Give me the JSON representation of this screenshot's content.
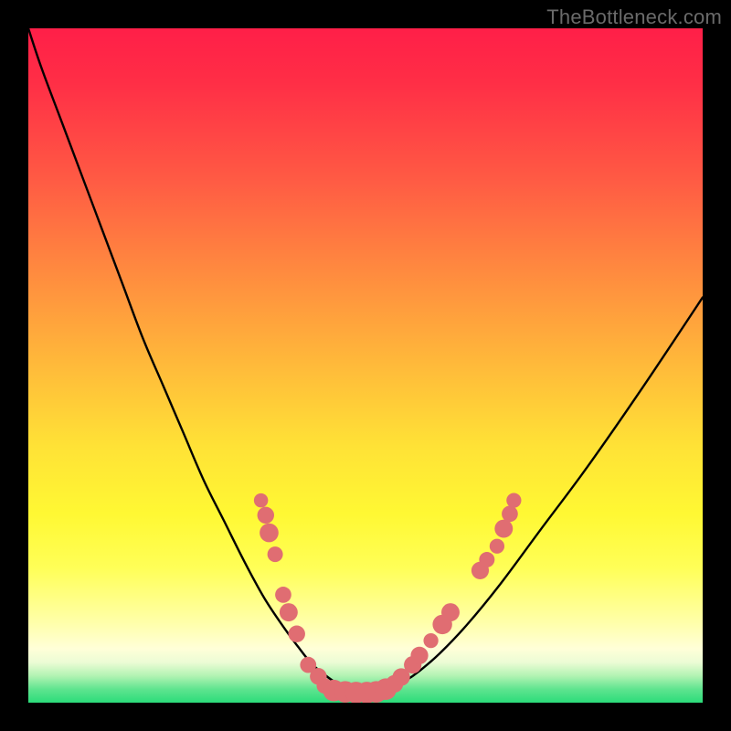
{
  "watermark": {
    "text": "TheBottleneck.com"
  },
  "colors": {
    "background": "#000000",
    "curve_stroke": "#000000",
    "dot_fill": "#e06d72",
    "gradient_stops": [
      "#ff1f48",
      "#ff2e46",
      "#ff5944",
      "#ff8a3f",
      "#ffba3a",
      "#ffe236",
      "#fff833",
      "#ffff57",
      "#ffffa8",
      "#ffffd8",
      "#ecfcd5",
      "#b3f3b3",
      "#5fe48f",
      "#2bdc7a"
    ]
  },
  "chart_data": {
    "type": "line",
    "title": "",
    "xlabel": "",
    "ylabel": "",
    "xlim": [
      0,
      100
    ],
    "ylim": [
      0,
      100
    ],
    "grid": false,
    "legend": false,
    "note": "Axes are unlabeled in the source image; values are in %-of-plot units (0 = bottom/left, 100 = top/right). The curve is a V-shaped bottleneck profile.",
    "series": [
      {
        "name": "bottleneck-curve",
        "x": [
          0,
          2,
          5,
          8,
          11,
          14,
          17,
          20,
          23,
          26,
          29,
          32,
          35,
          38,
          40,
          42,
          44,
          46,
          47.5,
          49,
          50.5,
          52,
          54,
          56,
          58,
          61,
          65,
          70,
          76,
          83,
          91,
          100
        ],
        "y": [
          100,
          94,
          86,
          78,
          70,
          62,
          54,
          47,
          40,
          33,
          27,
          21,
          15.5,
          11,
          8.3,
          5.8,
          4.1,
          2.7,
          2.0,
          1.6,
          1.6,
          1.7,
          2.3,
          3.3,
          4.7,
          7.3,
          11.5,
          17.6,
          25.7,
          35.1,
          46.6,
          60.1
        ]
      }
    ],
    "markers": [
      {
        "name": "highlight-dots",
        "comment": "Salmon sample dots clustered near the valley of the curve.",
        "points": [
          {
            "x": 34.5,
            "y": 30.0,
            "r": 1.05
          },
          {
            "x": 35.2,
            "y": 27.8,
            "r": 1.25
          },
          {
            "x": 35.7,
            "y": 25.2,
            "r": 1.4
          },
          {
            "x": 36.6,
            "y": 22.0,
            "r": 1.15
          },
          {
            "x": 37.8,
            "y": 16.0,
            "r": 1.2
          },
          {
            "x": 38.6,
            "y": 13.4,
            "r": 1.35
          },
          {
            "x": 39.8,
            "y": 10.2,
            "r": 1.25
          },
          {
            "x": 41.5,
            "y": 5.6,
            "r": 1.2
          },
          {
            "x": 43.0,
            "y": 3.9,
            "r": 1.25
          },
          {
            "x": 43.9,
            "y": 2.5,
            "r": 1.15
          },
          {
            "x": 45.3,
            "y": 1.8,
            "r": 1.6
          },
          {
            "x": 47.0,
            "y": 1.6,
            "r": 1.6
          },
          {
            "x": 48.6,
            "y": 1.5,
            "r": 1.6
          },
          {
            "x": 50.2,
            "y": 1.5,
            "r": 1.6
          },
          {
            "x": 51.6,
            "y": 1.6,
            "r": 1.6
          },
          {
            "x": 53.0,
            "y": 2.0,
            "r": 1.6
          },
          {
            "x": 54.3,
            "y": 2.8,
            "r": 1.3
          },
          {
            "x": 55.3,
            "y": 3.8,
            "r": 1.3
          },
          {
            "x": 57.0,
            "y": 5.6,
            "r": 1.3
          },
          {
            "x": 58.0,
            "y": 7.0,
            "r": 1.3
          },
          {
            "x": 59.7,
            "y": 9.2,
            "r": 1.1
          },
          {
            "x": 61.4,
            "y": 11.6,
            "r": 1.45
          },
          {
            "x": 62.6,
            "y": 13.4,
            "r": 1.35
          },
          {
            "x": 67.0,
            "y": 19.6,
            "r": 1.3
          },
          {
            "x": 68.0,
            "y": 21.2,
            "r": 1.15
          },
          {
            "x": 69.5,
            "y": 23.2,
            "r": 1.1
          },
          {
            "x": 70.5,
            "y": 25.8,
            "r": 1.35
          },
          {
            "x": 71.4,
            "y": 28.0,
            "r": 1.2
          },
          {
            "x": 72.0,
            "y": 30.0,
            "r": 1.1
          }
        ]
      }
    ]
  }
}
